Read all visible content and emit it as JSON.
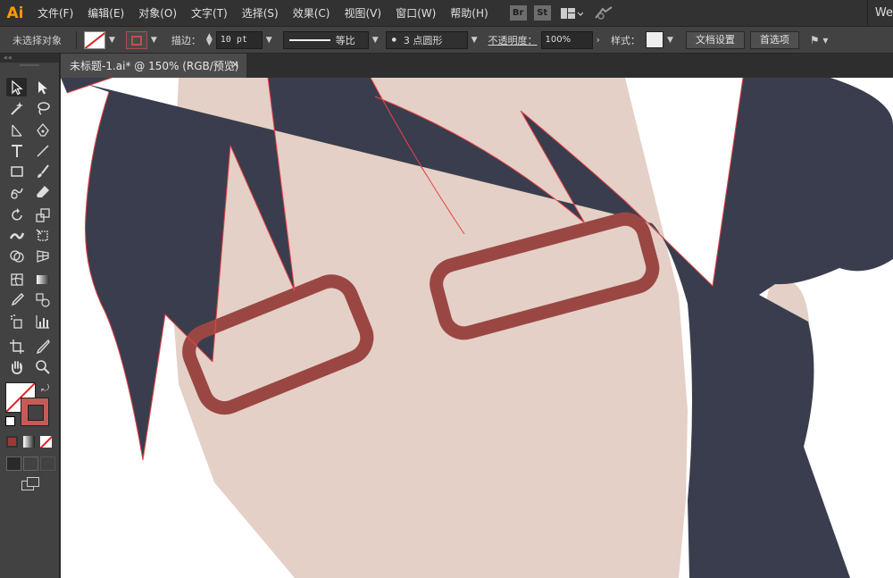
{
  "app": {
    "logo": "Ai",
    "menu": [
      "文件(F)",
      "编辑(E)",
      "对象(O)",
      "文字(T)",
      "选择(S)",
      "效果(C)",
      "视图(V)",
      "窗口(W)",
      "帮助(H)"
    ],
    "menubar_icons": [
      "Br",
      "St"
    ],
    "right_text": "We"
  },
  "control_panel": {
    "selection_status": "未选择对象",
    "stroke_label": "描边：",
    "stroke_weight": "10 pt",
    "line_profile": "等比",
    "brush": "3 点圆形",
    "opacity_label": "不透明度：",
    "opacity_value": "100%",
    "style_label": "样式：",
    "doc_setup_button": "文档设置",
    "preferences_button": "首选项"
  },
  "document": {
    "tab_title": "未标题-1.ai* @ 150% (RGB/预览)"
  },
  "colors": {
    "hair": "#3a3d4d",
    "skin": "#e4d0c6",
    "glasses": "#9a4744",
    "selection": "#e8454a"
  }
}
